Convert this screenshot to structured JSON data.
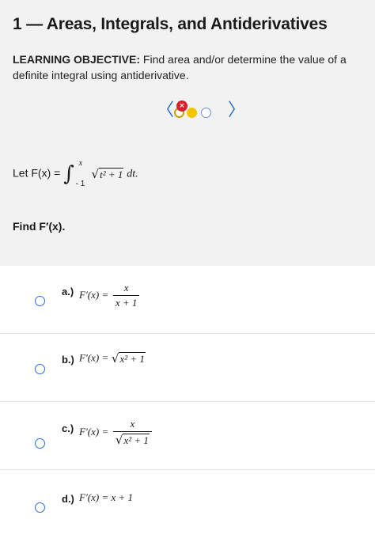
{
  "header": {
    "title": "1 — Areas, Integrals, and Antiderivatives",
    "objective_label": "LEARNING OBJECTIVE:",
    "objective_text": "Find area and/or determine the value of a definite integral using antiderivative."
  },
  "pager": {
    "prev_symbol": "〈",
    "next_symbol": "〉",
    "dots": [
      {
        "state": "incorrect",
        "badge": "×"
      },
      {
        "state": "current"
      },
      {
        "state": "unanswered"
      }
    ],
    "colors": {
      "accent": "#2a6fd6",
      "current": "#f5c400",
      "incorrect": "#d6202a"
    }
  },
  "question": {
    "prefix": "Let F(x) = ",
    "integral_sign": "∫",
    "upper_limit": "x",
    "lower_limit": "- 1",
    "radical": "√",
    "integrand": "t² + 1",
    "differential": " dt.",
    "prompt": "Find F′(x)."
  },
  "options": [
    {
      "label": "a.)",
      "lhs": "F′(x) =",
      "num": "x",
      "den": "x + 1"
    },
    {
      "label": "b.)",
      "lhs": "F′(x) =",
      "radical": "√",
      "expr": "x² + 1"
    },
    {
      "label": "c.)",
      "lhs": "F′(x) =",
      "num": "x",
      "den_radical": "√",
      "den": "x² + 1"
    },
    {
      "label": "d.)",
      "lhs": "F′(x) = x + 1"
    }
  ]
}
